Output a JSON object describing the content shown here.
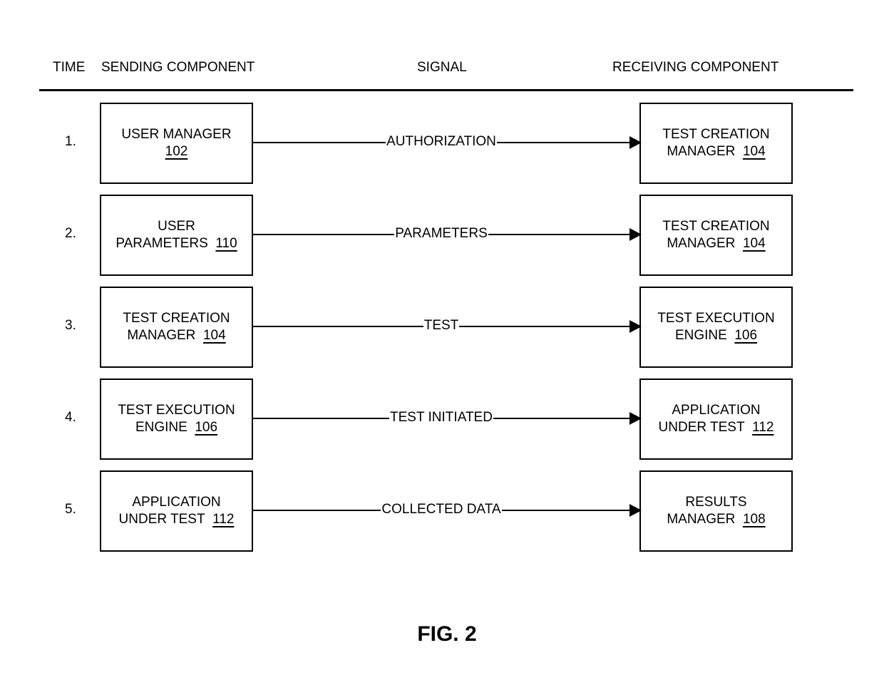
{
  "headers": {
    "time": "TIME",
    "sending": "SENDING COMPONENT",
    "signal": "SIGNAL",
    "receiving": "RECEIVING COMPONENT"
  },
  "rows": [
    {
      "time": "1.",
      "sender": {
        "lines": [
          "USER MANAGER"
        ],
        "ref": "102"
      },
      "signal": "AUTHORIZATION",
      "receiver": {
        "lines": [
          "TEST CREATION",
          "MANAGER"
        ],
        "ref": "104"
      }
    },
    {
      "time": "2.",
      "sender": {
        "lines": [
          "USER",
          "PARAMETERS"
        ],
        "ref": "110"
      },
      "signal": "PARAMETERS",
      "receiver": {
        "lines": [
          "TEST CREATION",
          "MANAGER"
        ],
        "ref": "104"
      }
    },
    {
      "time": "3.",
      "sender": {
        "lines": [
          "TEST CREATION",
          "MANAGER"
        ],
        "ref": "104"
      },
      "signal": "TEST",
      "receiver": {
        "lines": [
          "TEST EXECUTION",
          "ENGINE"
        ],
        "ref": "106"
      }
    },
    {
      "time": "4.",
      "sender": {
        "lines": [
          "TEST EXECUTION",
          "ENGINE"
        ],
        "ref": "106"
      },
      "signal": "TEST INITIATED",
      "receiver": {
        "lines": [
          "APPLICATION",
          "UNDER TEST"
        ],
        "ref": "112"
      }
    },
    {
      "time": "5.",
      "sender": {
        "lines": [
          "APPLICATION",
          "UNDER TEST"
        ],
        "ref": "112"
      },
      "signal": "COLLECTED DATA",
      "receiver": {
        "lines": [
          "RESULTS",
          "MANAGER"
        ],
        "ref": "108"
      }
    }
  ],
  "figure_label": "FIG. 2"
}
